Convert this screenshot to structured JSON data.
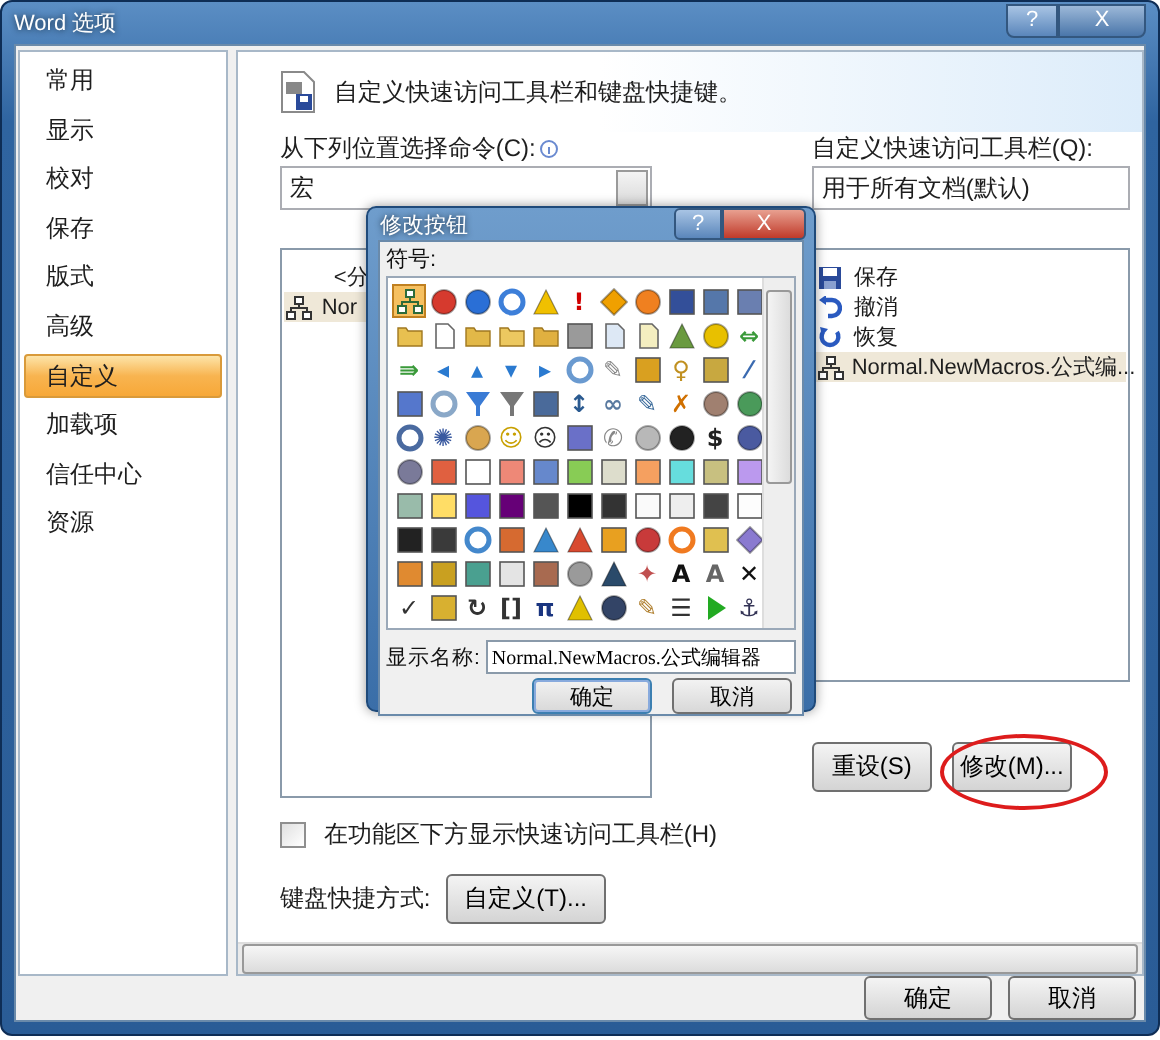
{
  "window": {
    "title": "Word 选项",
    "buttons": [
      "?",
      "X"
    ]
  },
  "sidebar": {
    "items": [
      {
        "label": "常用",
        "selected": false
      },
      {
        "label": "显示",
        "selected": false
      },
      {
        "label": "校对",
        "selected": false
      },
      {
        "label": "保存",
        "selected": false
      },
      {
        "label": "版式",
        "selected": false
      },
      {
        "label": "高级",
        "selected": false
      },
      {
        "label": "自定义",
        "selected": true
      },
      {
        "label": "加载项",
        "selected": false
      },
      {
        "label": "信任中心",
        "selected": false
      },
      {
        "label": "资源",
        "selected": false
      }
    ]
  },
  "header": {
    "title": "自定义快速访问工具栏和键盘快捷键。"
  },
  "choose_commands": {
    "label": "从下列位置选择命令(C):",
    "value": "宏",
    "items": [
      {
        "label": "<分",
        "kind": "separator",
        "selected": false
      },
      {
        "label": "Nor",
        "kind": "macro",
        "selected": true
      }
    ]
  },
  "customize_toolbar": {
    "label": "自定义快速访问工具栏(Q):",
    "value": "用于所有文档(默认)",
    "items": [
      {
        "label": "保存",
        "kind": "save",
        "selected": false
      },
      {
        "label": "撤消",
        "kind": "undo",
        "selected": false
      },
      {
        "label": "恢复",
        "kind": "redo",
        "selected": false
      },
      {
        "label": "Normal.NewMacros.公式编...",
        "kind": "macro",
        "selected": true
      }
    ],
    "buttons": [
      {
        "label": "重设(S)",
        "highlighted": false
      },
      {
        "label": "修改(M)...",
        "highlighted": true
      }
    ]
  },
  "show_below_ribbon": {
    "label": "在功能区下方显示快速访问工具栏(H)",
    "checked": false
  },
  "keyboard": {
    "label": "键盘快捷方式:",
    "button": "自定义(T)..."
  },
  "footer": {
    "buttons": [
      "确定",
      "取消"
    ]
  },
  "dialog": {
    "title": "修改按钮",
    "buttons": [
      "?",
      "X"
    ],
    "symbols_label": "符号:",
    "name_label": "显示名称:",
    "name_value": "Normal.NewMacros.公式编辑器",
    "ok": "确定",
    "cancel": "取消",
    "symbols": [
      {
        "kind": "tree",
        "color": "#2d6b3a",
        "selected": true
      },
      {
        "kind": "dot",
        "color": "#d63a2e",
        "selected": false
      },
      {
        "kind": "dot",
        "color": "#2a6fd6",
        "selected": false
      },
      {
        "kind": "ring",
        "color": "#3d7fd9",
        "selected": false
      },
      {
        "kind": "tri",
        "color": "#f0c000",
        "selected": false
      },
      {
        "kind": "char",
        "text": "!",
        "color": "#d00000",
        "selected": false
      },
      {
        "kind": "diamond",
        "color": "#f0a000",
        "selected": false
      },
      {
        "kind": "dot",
        "color": "#f08020",
        "selected": false
      },
      {
        "kind": "square",
        "color": "#334f99",
        "selected": false
      },
      {
        "kind": "square",
        "color": "#5577aa",
        "selected": false
      },
      {
        "kind": "square",
        "color": "#6a7fb0",
        "selected": false
      },
      {
        "kind": "folder",
        "color": "#e8c050",
        "selected": false
      },
      {
        "kind": "doc",
        "color": "#ffffff",
        "selected": false
      },
      {
        "kind": "folder",
        "color": "#e2b848",
        "selected": false
      },
      {
        "kind": "folder",
        "color": "#ecc860",
        "selected": false
      },
      {
        "kind": "folder",
        "color": "#e0b040",
        "selected": false
      },
      {
        "kind": "square",
        "color": "#9a9a9a",
        "selected": false
      },
      {
        "kind": "doc",
        "color": "#dde8f5",
        "selected": false
      },
      {
        "kind": "doc",
        "color": "#f4eec0",
        "selected": false
      },
      {
        "kind": "tri",
        "color": "#6a9a40",
        "selected": false
      },
      {
        "kind": "dot",
        "color": "#e8c000",
        "selected": false
      },
      {
        "kind": "char",
        "text": "⇔",
        "color": "#3a9a3a",
        "selected": false
      },
      {
        "kind": "char",
        "text": "⇛",
        "color": "#3a9a3a",
        "selected": false
      },
      {
        "kind": "char",
        "text": "◂",
        "color": "#2a7ad0",
        "selected": false
      },
      {
        "kind": "char",
        "text": "▴",
        "color": "#2a7ad0",
        "selected": false
      },
      {
        "kind": "char",
        "text": "▾",
        "color": "#2a7ad0",
        "selected": false
      },
      {
        "kind": "char",
        "text": "▸",
        "color": "#2a7ad0",
        "selected": false
      },
      {
        "kind": "ring",
        "color": "#6a9ad0",
        "selected": false
      },
      {
        "kind": "char",
        "text": "✎",
        "color": "#888888",
        "selected": false
      },
      {
        "kind": "square",
        "color": "#d9a020",
        "selected": false
      },
      {
        "kind": "char",
        "text": "♀",
        "color": "#c09020",
        "selected": false
      },
      {
        "kind": "square",
        "color": "#c8a840",
        "selected": false
      },
      {
        "kind": "char",
        "text": "⁄",
        "color": "#3a6ab0",
        "selected": false
      },
      {
        "kind": "square",
        "color": "#5577cc",
        "selected": false
      },
      {
        "kind": "ring",
        "color": "#8aa8c8",
        "selected": false
      },
      {
        "kind": "vtri",
        "color": "#3a7bd5",
        "selected": false
      },
      {
        "kind": "vtri",
        "color": "#777777",
        "selected": false
      },
      {
        "kind": "square",
        "color": "#4a6a9a",
        "selected": false
      },
      {
        "kind": "char",
        "text": "↕",
        "color": "#2a5a90",
        "selected": false
      },
      {
        "kind": "char",
        "text": "∞",
        "color": "#5a7aa0",
        "selected": false
      },
      {
        "kind": "char",
        "text": "✎",
        "color": "#3a6a9a",
        "selected": false
      },
      {
        "kind": "char",
        "text": "✗",
        "color": "#d07000",
        "selected": false
      },
      {
        "kind": "dot",
        "color": "#a08070",
        "selected": false
      },
      {
        "kind": "dot",
        "color": "#4a9a5a",
        "selected": false
      },
      {
        "kind": "ring",
        "color": "#4a6aa0",
        "selected": false
      },
      {
        "kind": "char",
        "text": "✺",
        "color": "#3a5aa0",
        "selected": false
      },
      {
        "kind": "dot",
        "color": "#d9a650",
        "selected": false
      },
      {
        "kind": "char",
        "text": "☺",
        "color": "#c8a000",
        "selected": false
      },
      {
        "kind": "char",
        "text": "☹",
        "color": "#333333",
        "selected": false
      },
      {
        "kind": "square",
        "color": "#6a70c8",
        "selected": false
      },
      {
        "kind": "char",
        "text": "✆",
        "color": "#888888",
        "selected": false
      },
      {
        "kind": "dot",
        "color": "#b8b8b8",
        "selected": false
      },
      {
        "kind": "dot",
        "color": "#222222",
        "selected": false
      },
      {
        "kind": "char",
        "text": "$",
        "color": "#222222",
        "selected": false
      },
      {
        "kind": "dot",
        "color": "#4a5aa0",
        "selected": false
      },
      {
        "kind": "dot",
        "color": "#7a7a99",
        "selected": false
      },
      {
        "kind": "square",
        "color": "#e06040",
        "selected": false
      },
      {
        "kind": "square",
        "color": "#ffffff",
        "selected": false
      },
      {
        "kind": "square",
        "color": "#ee8877",
        "selected": false
      },
      {
        "kind": "square",
        "color": "#6688cc",
        "selected": false
      },
      {
        "kind": "square",
        "color": "#88cc55",
        "selected": false
      },
      {
        "kind": "square",
        "color": "#ddddcc",
        "selected": false
      },
      {
        "kind": "square",
        "color": "#f5a060",
        "selected": false
      },
      {
        "kind": "square",
        "color": "#66dddd",
        "selected": false
      },
      {
        "kind": "square",
        "color": "#c8c080",
        "selected": false
      },
      {
        "kind": "square",
        "color": "#bb99ee",
        "selected": false
      },
      {
        "kind": "square",
        "color": "#99bbaa",
        "selected": false
      },
      {
        "kind": "square",
        "color": "#ffdd66",
        "selected": false
      },
      {
        "kind": "square",
        "color": "#5555dd",
        "selected": false
      },
      {
        "kind": "square",
        "color": "#660077",
        "selected": false
      },
      {
        "kind": "square",
        "color": "#555555",
        "selected": false
      },
      {
        "kind": "square",
        "color": "#000000",
        "selected": false
      },
      {
        "kind": "square",
        "color": "#333333",
        "selected": false
      },
      {
        "kind": "square",
        "color": "#fafafa",
        "selected": false
      },
      {
        "kind": "square",
        "color": "#eeeeee",
        "selected": false
      },
      {
        "kind": "square",
        "color": "#444444",
        "selected": false
      },
      {
        "kind": "square",
        "color": "#fdfdfd",
        "selected": false
      },
      {
        "kind": "square",
        "color": "#222222",
        "selected": false
      },
      {
        "kind": "square",
        "color": "#3a3a3a",
        "selected": false
      },
      {
        "kind": "ring",
        "color": "#4488cc",
        "selected": false
      },
      {
        "kind": "square",
        "color": "#d66a30",
        "selected": false
      },
      {
        "kind": "tri",
        "color": "#3888cc",
        "selected": false
      },
      {
        "kind": "tri",
        "color": "#d84a30",
        "selected": false
      },
      {
        "kind": "square",
        "color": "#e8a020",
        "selected": false
      },
      {
        "kind": "dot",
        "color": "#c83a3a",
        "selected": false
      },
      {
        "kind": "ring",
        "color": "#f07a20",
        "selected": false
      },
      {
        "kind": "square",
        "color": "#e0c050",
        "selected": false
      },
      {
        "kind": "diamond",
        "color": "#8a7ad0",
        "selected": false
      },
      {
        "kind": "square",
        "color": "#e08a30",
        "selected": false
      },
      {
        "kind": "square",
        "color": "#c9a020",
        "selected": false
      },
      {
        "kind": "square",
        "color": "#4aa090",
        "selected": false
      },
      {
        "kind": "square",
        "color": "#e4e4e4",
        "selected": false
      },
      {
        "kind": "square",
        "color": "#a86a50",
        "selected": false
      },
      {
        "kind": "dot",
        "color": "#9a9a9a",
        "selected": false
      },
      {
        "kind": "tri",
        "color": "#2a4a6a",
        "selected": false
      },
      {
        "kind": "char",
        "text": "✦",
        "color": "#c05050",
        "selected": false
      },
      {
        "kind": "char",
        "text": "A",
        "color": "#111111",
        "selected": false
      },
      {
        "kind": "char",
        "text": "A",
        "color": "#666666",
        "selected": false
      },
      {
        "kind": "char",
        "text": "✕",
        "color": "#111111",
        "selected": false
      },
      {
        "kind": "char",
        "text": "✓",
        "color": "#333333",
        "selected": false
      },
      {
        "kind": "square",
        "color": "#d8b030",
        "selected": false
      },
      {
        "kind": "char",
        "text": "↻",
        "color": "#333333",
        "selected": false
      },
      {
        "kind": "char",
        "text": "[]",
        "color": "#333333",
        "selected": false
      },
      {
        "kind": "char",
        "text": "π",
        "color": "#1a3580",
        "selected": false
      },
      {
        "kind": "tri",
        "color": "#e0c000",
        "selected": false
      },
      {
        "kind": "dot",
        "color": "#334466",
        "selected": false
      },
      {
        "kind": "char",
        "text": "✎",
        "color": "#b08030",
        "selected": false
      },
      {
        "kind": "char",
        "text": "☰",
        "color": "#333333",
        "selected": false
      },
      {
        "kind": "rtri",
        "color": "#22aa22",
        "selected": false
      },
      {
        "kind": "char",
        "text": "⚓",
        "color": "#333355",
        "selected": false
      }
    ]
  }
}
